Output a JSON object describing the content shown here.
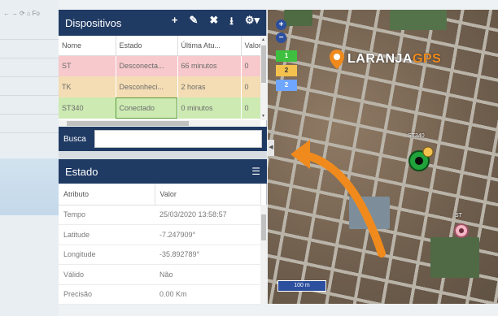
{
  "browser": {
    "nav": [
      "←",
      "→",
      "⟳",
      "⌂",
      "Fo"
    ]
  },
  "devices_panel": {
    "title": "Dispositivos",
    "tools": {
      "add": "+",
      "edit": "✎",
      "remove": "✖",
      "upload": "⭳",
      "settings": "⚙▾"
    },
    "columns": [
      "Nome",
      "Estado",
      "Última Atu...",
      "Valor"
    ],
    "rows": [
      {
        "name": "ST",
        "status": "Desconecta...",
        "last_update": "66 minutos",
        "value": "0",
        "color": "#f7c9cc"
      },
      {
        "name": "TK",
        "status": "Desconheci...",
        "last_update": "2 horas",
        "value": "0",
        "color": "#f4ddb4"
      },
      {
        "name": "ST340",
        "status": "Conectado",
        "last_update": "0 minutos",
        "value": "0",
        "color": "#cdeab3"
      }
    ]
  },
  "search": {
    "label": "Busca",
    "value": ""
  },
  "state_panel": {
    "title": "Estado",
    "columns": [
      "Atributo",
      "Valor"
    ],
    "rows": [
      {
        "attr": "Tempo",
        "value": "25/03/2020 13:58:57"
      },
      {
        "attr": "Latitude",
        "value": "-7.247909°"
      },
      {
        "attr": "Longitude",
        "value": "-35.892789°"
      },
      {
        "attr": "Válido",
        "value": "Não"
      },
      {
        "attr": "Precisão",
        "value": "0.00 Km"
      }
    ]
  },
  "map": {
    "zoom_in": "+",
    "zoom_out": "−",
    "legend": [
      {
        "label": "1",
        "color": "#3fbf3f"
      },
      {
        "label": "2",
        "color": "#f2c14e"
      },
      {
        "label": "2",
        "color": "#6fa6ff"
      }
    ],
    "logo": {
      "text_main": "LARANJA",
      "text_accent": "GPS"
    },
    "markers": {
      "green_label": "ST340",
      "pink_label": "ST"
    },
    "scale": "100 m",
    "accent_color": "#f08a1c"
  }
}
